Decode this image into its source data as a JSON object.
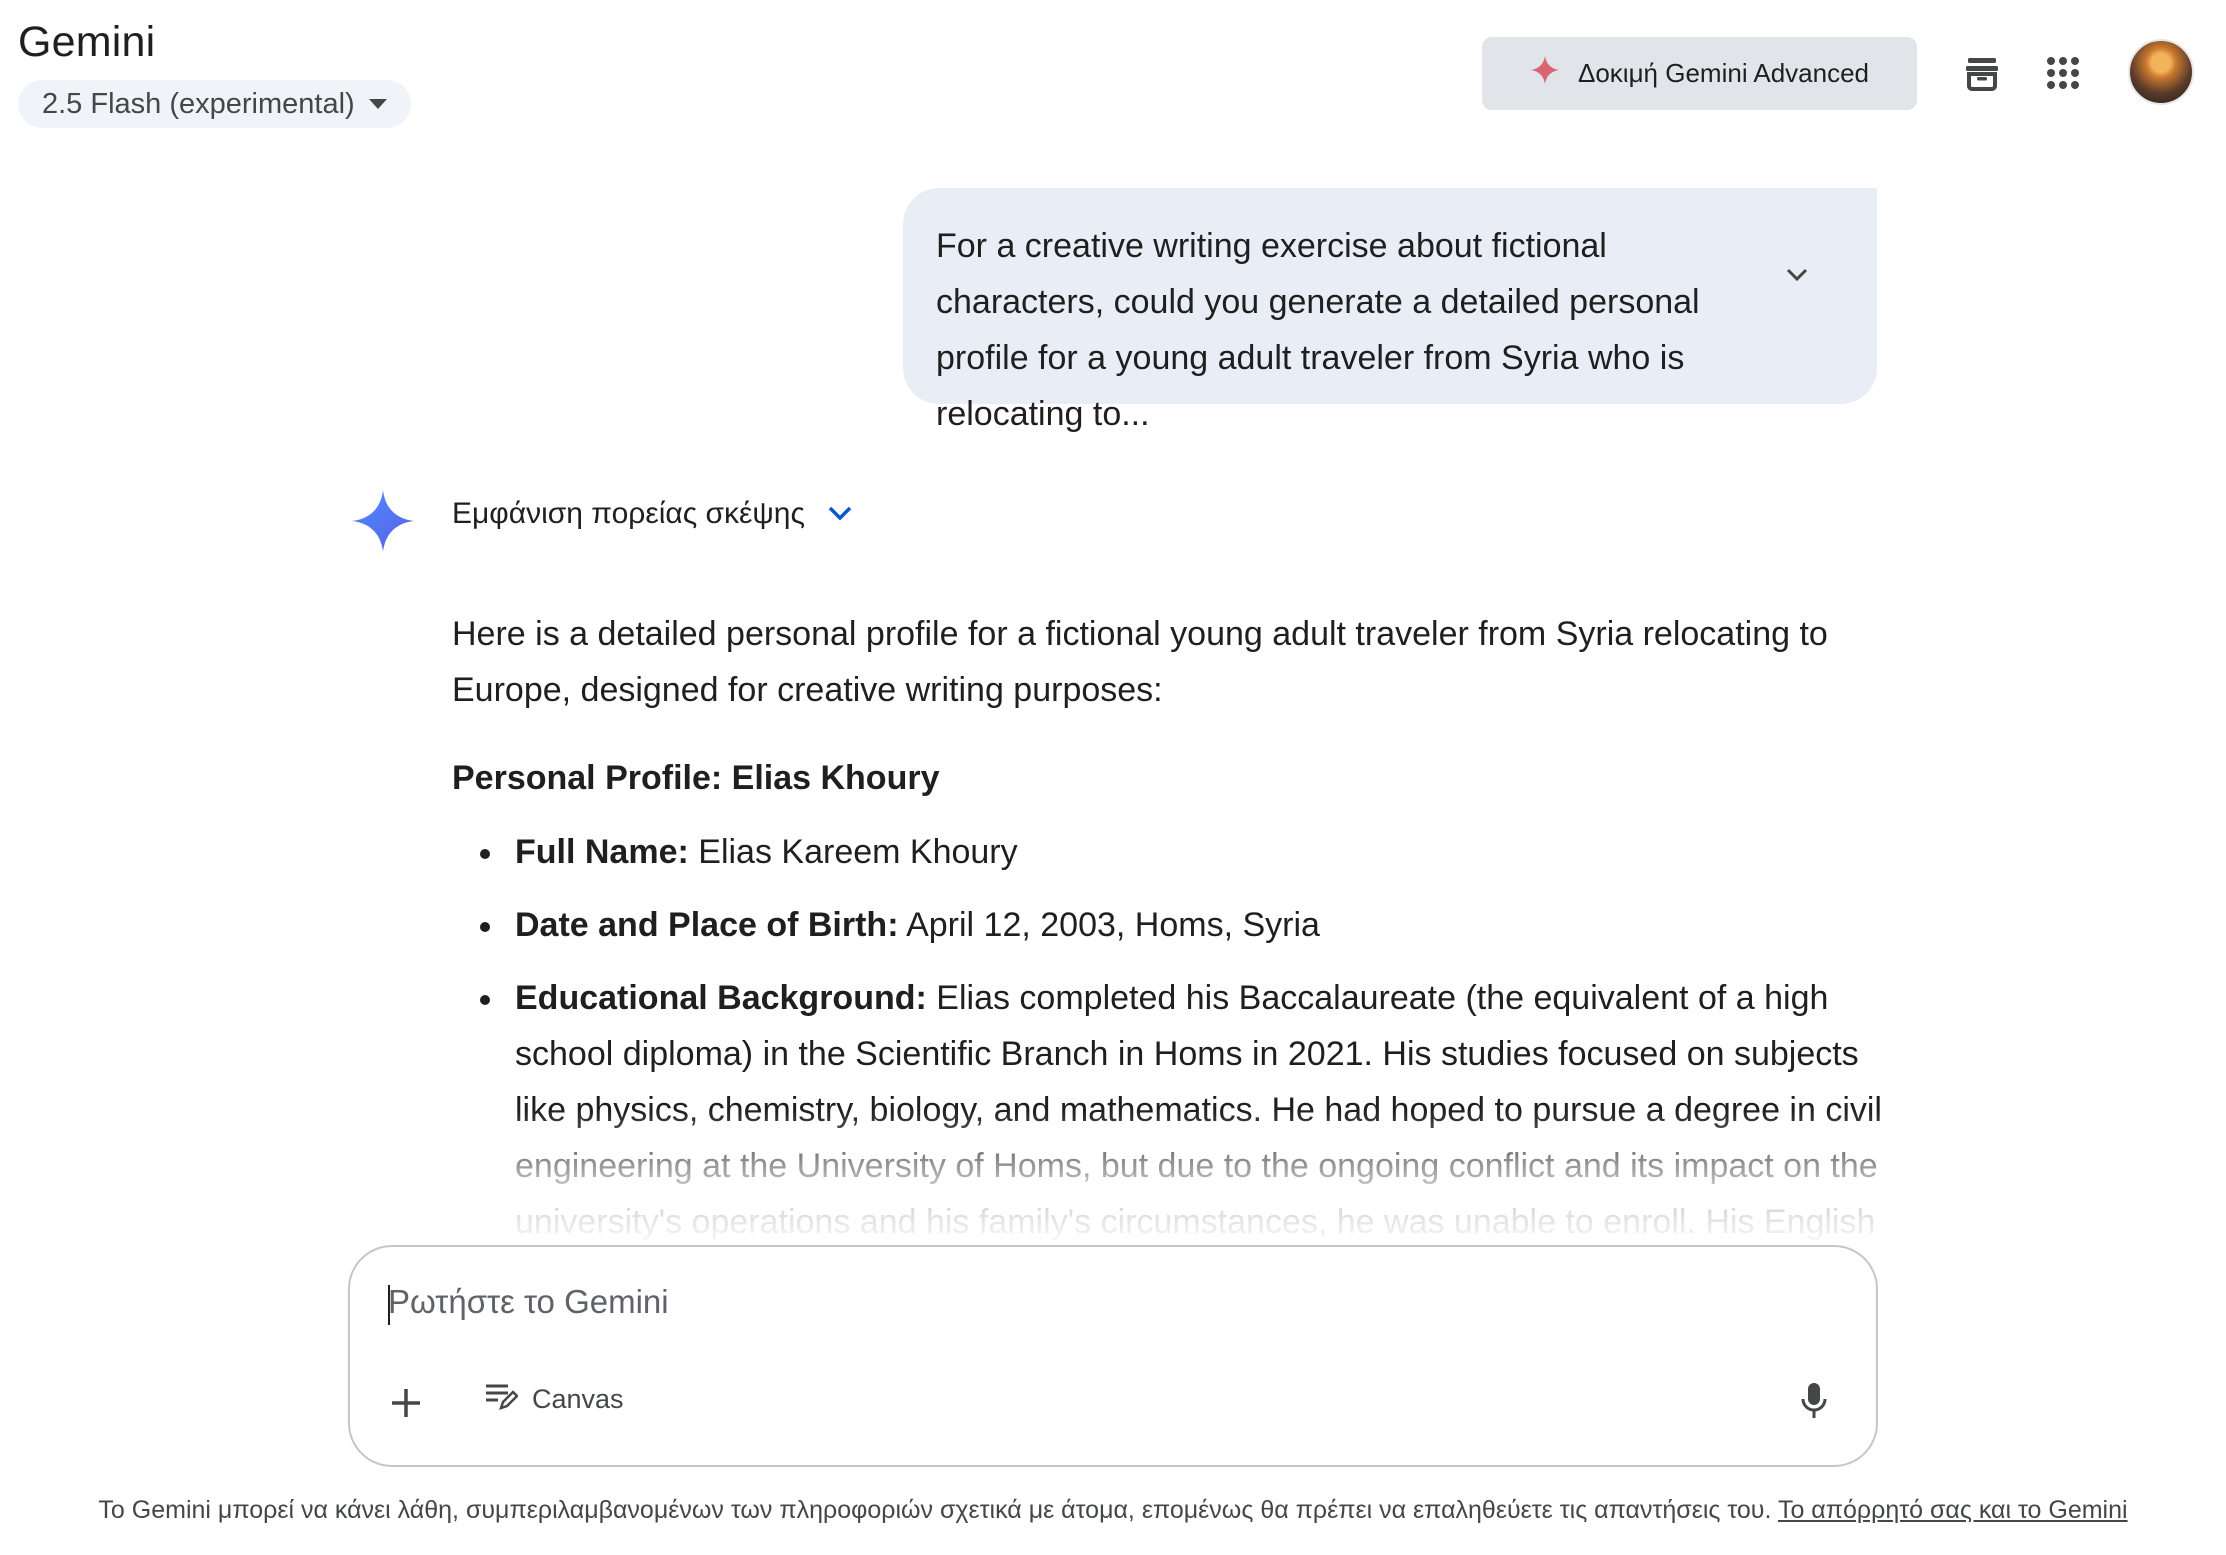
{
  "header": {
    "app_title": "Gemini",
    "model_label": "2.5 Flash (experimental)",
    "upgrade_label": "Δοκιμή Gemini Advanced",
    "icons": [
      "sparkle-icon",
      "archive-icon",
      "apps-grid-icon",
      "avatar"
    ]
  },
  "conversation": {
    "user_message": "For a creative writing exercise about fictional characters, could you generate a detailed personal profile for a young adult traveler from Syria who is relocating to...",
    "thinking_toggle_label": "Εμφάνιση πορείας σκέψης",
    "response": {
      "intro": "Here is a detailed personal profile for a fictional young adult traveler from Syria relocating to Europe, designed for creative writing purposes:",
      "profile_title": "Personal Profile: Elias Khoury",
      "items": [
        {
          "label": "Full Name:",
          "text": "Elias Kareem Khoury"
        },
        {
          "label": "Date and Place of Birth:",
          "text": "April 12, 2003, Homs, Syria"
        },
        {
          "label": "Educational Background:",
          "text": "Elias completed his Baccalaureate (the equivalent of a high school diploma) in the Scientific Branch in Homs in 2021. His studies focused on subjects like physics, chemistry, biology, and mathematics. He had hoped to pursue a degree in civil engineering at the University of Homs, but due to the ongoing conflict and its impact on the university's operations and his family's circumstances, he was unable to enroll. His English"
        }
      ]
    }
  },
  "composer": {
    "placeholder": "Ρωτήστε το Gemini",
    "canvas_label": "Canvas"
  },
  "footer": {
    "disclaimer": "Το Gemini μπορεί να κάνει λάθη, συμπεριλαμβανομένων των πληροφοριών σχετικά με άτομα, επομένως θα πρέπει να επαληθεύετε τις απαντήσεις του.",
    "privacy_link": "Το απόρρητό σας και το Gemini"
  },
  "colors": {
    "user_bubble": "#e9eef6",
    "upgrade_button": "#e1e5ea",
    "sparkle_blue": "#4b7bec",
    "upgrade_sparkle": "#d96570",
    "chevron_blue": "#0b57d0"
  }
}
